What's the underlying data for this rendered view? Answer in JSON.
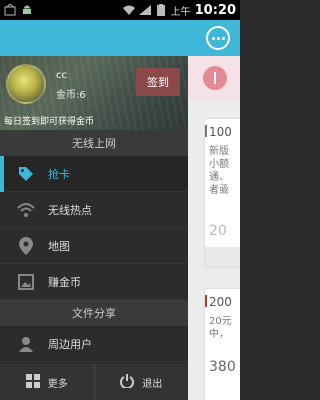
{
  "status_bar": {
    "ampm": "上午",
    "time": "10:20"
  },
  "profile": {
    "username": "cc",
    "coins_label": "金币:6",
    "checkin_label": "签到",
    "hint": "每日签到即可获得金币"
  },
  "sections": {
    "wireless": "无线上网",
    "file_share": "文件分享"
  },
  "menu": {
    "grab_card": "抢卡",
    "hotspot": "无线热点",
    "map": "地图",
    "earn_coins": "赚金币",
    "nearby_users": "周边用户"
  },
  "bottom": {
    "more": "更多",
    "exit": "退出"
  },
  "content": {
    "card1": {
      "title": "100",
      "desc": "新版\n小额\n通、\n者亟",
      "num": "20"
    },
    "card2": {
      "title": "200",
      "desc": "20元\n中，",
      "num": "380"
    }
  },
  "colors": {
    "accent": "#3fb7d9",
    "checkin_bg": "#8a4a4a",
    "card1_mark": "#777777",
    "card2_mark": "#c0392b"
  }
}
